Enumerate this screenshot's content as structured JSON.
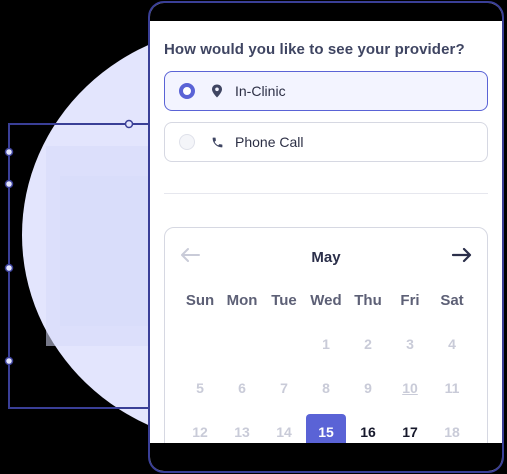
{
  "question": "How would you like to see your provider?",
  "options": [
    {
      "label": "In-Clinic",
      "icon": "location-pin-icon",
      "selected": true
    },
    {
      "label": "Phone Call",
      "icon": "phone-icon",
      "selected": false
    }
  ],
  "calendar": {
    "month": "May",
    "weekdays": [
      "Sun",
      "Mon",
      "Tue",
      "Wed",
      "Thu",
      "Fri",
      "Sat"
    ],
    "rows": [
      [
        "",
        "",
        "",
        "1",
        "2",
        "3",
        "4"
      ],
      [
        "5",
        "6",
        "7",
        "8",
        "9",
        "10",
        "11"
      ],
      [
        "12",
        "13",
        "14",
        "15",
        "16",
        "17",
        "18"
      ]
    ],
    "selected_day": "15",
    "available_days": [
      "16",
      "17"
    ],
    "underlined_day": "10"
  },
  "colors": {
    "accent": "#5a63d6",
    "frame": "#3a3f97",
    "background_circle": "#e3e5fd"
  }
}
